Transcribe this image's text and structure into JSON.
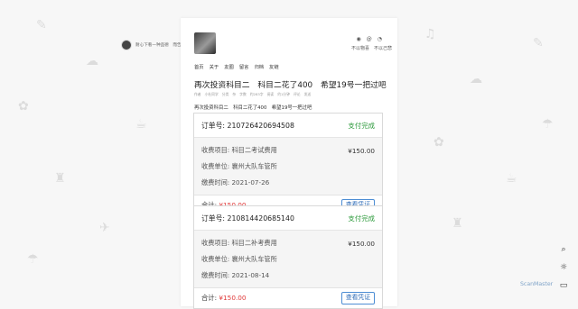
{
  "side_chip": {
    "text": "耐心下看一种品德　而告"
  },
  "header": {
    "icons": [
      "github-icon",
      "at-icon",
      "rss-icon"
    ],
    "links": [
      "不以物喜",
      "不以己悲"
    ]
  },
  "nav": [
    "首页",
    "关于",
    "友圈",
    "留言",
    "归档",
    "友链"
  ],
  "post": {
    "title": "再次投资科目二　科目二花了400　希望19号一把过吧",
    "meta": [
      "作者",
      "小杜同学",
      "分类",
      "杂",
      "字数",
      "约283字",
      "阅读",
      "约1分钟",
      "评论",
      "发送"
    ],
    "desc": "再次投资科目二　科目二花了400　希望19号一把过吧"
  },
  "orders": [
    {
      "order_label": "订单号:",
      "order_no": "210726420694508",
      "status": "支付完成",
      "item_label": "收费项目: 科目二考试费用",
      "amount": "¥150.00",
      "unit_label": "收费单位: 襄州大队车管所",
      "time_label": "缴费时间: 2021-07-26",
      "total_label": "合计:",
      "total_value": "¥150.00",
      "voucher": "查看凭证"
    },
    {
      "order_label": "订单号:",
      "order_no": "210814420685140",
      "status": "支付完成",
      "item_label": "收费项目: 科目二补考费用",
      "amount": "¥150.00",
      "unit_label": "收费单位: 襄州大队车管所",
      "time_label": "缴费时间: 2021-08-14",
      "total_label": "合计:",
      "total_value": "¥150.00",
      "voucher": "查看凭证"
    }
  ],
  "tools": [
    "search-icon",
    "theme-toggle-icon",
    "comment-icon"
  ],
  "watermark": "ScanMaster"
}
